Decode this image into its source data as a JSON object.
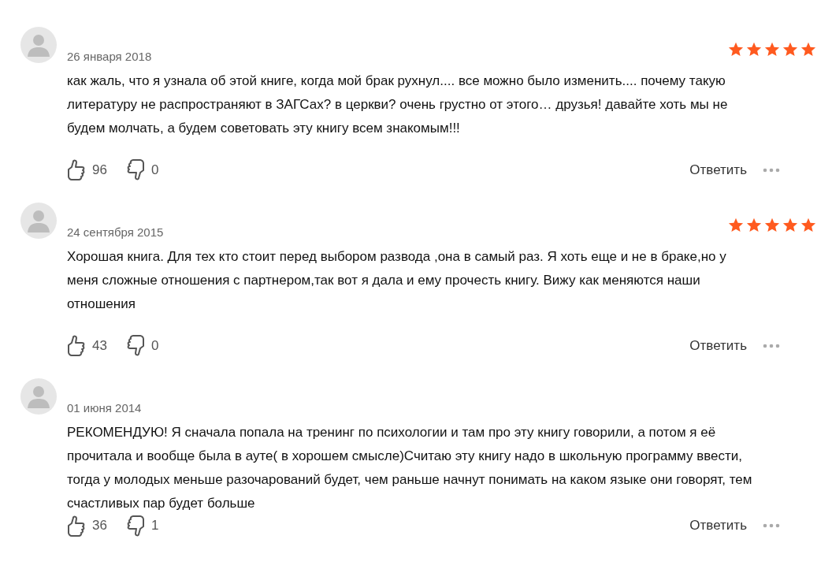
{
  "reviews": [
    {
      "date": "26 января 2018",
      "stars": 5,
      "text": "как жаль, что я узнала об этой книге, когда мой брак рухнул.... все можно было изменить.... почему такую литературу не распространяют в ЗАГСах? в церкви? очень грустно от этого… друзья! давайте хоть мы не будем молчать, а будем советовать эту книгу всем знакомым!!!",
      "likes": "96",
      "dislikes": "0",
      "reply": "Ответить"
    },
    {
      "date": "24 сентября 2015",
      "stars": 5,
      "text": "Хорошая книга. Для тех кто стоит перед выбором развода ,она в самый раз. Я хоть еще и не в браке,но у меня сложные отношения с партнером,так вот я дала и ему прочесть книгу. Вижу как меняются наши отношения",
      "likes": "43",
      "dislikes": "0",
      "reply": "Ответить"
    },
    {
      "date": "01 июня 2014",
      "text": "РЕКОМЕНДУЮ! Я сначала попала на тренинг по психологии и там про эту книгу говорили, а потом я её прочитала и вообще была в ауте( в хорошем смысле)Считаю эту книгу надо в школьную программу ввести, тогда у молодых меньше разочарований будет, чем раньше начнут понимать на каком языке они говорят, тем счастливых пар будет больше",
      "likes": "36",
      "dislikes": "1",
      "reply": "Ответить"
    }
  ]
}
